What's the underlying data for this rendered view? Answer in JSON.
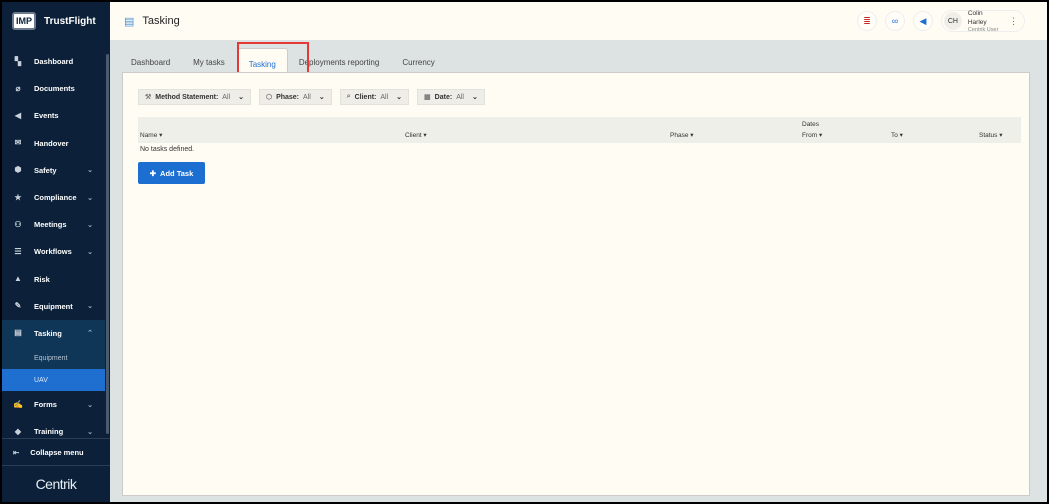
{
  "sidebar": {
    "brand_badge": "IMP",
    "brand": "TrustFlight",
    "items": [
      {
        "label": "Dashboard",
        "icon": "▚"
      },
      {
        "label": "Documents",
        "icon": "⌀"
      },
      {
        "label": "Events",
        "icon": "◀"
      },
      {
        "label": "Handover",
        "icon": "✉"
      },
      {
        "label": "Safety",
        "icon": "⬢"
      },
      {
        "label": "Compliance",
        "icon": "★"
      },
      {
        "label": "Meetings",
        "icon": "⚇"
      },
      {
        "label": "Workflows",
        "icon": "☰"
      },
      {
        "label": "Risk",
        "icon": "▲"
      },
      {
        "label": "Equipment",
        "icon": "✎"
      },
      {
        "label": "Tasking",
        "icon": "▤"
      },
      {
        "label": "Forms",
        "icon": "✍"
      },
      {
        "label": "Training",
        "icon": "◆"
      }
    ],
    "sub_items": [
      "Equipment",
      "UAV"
    ],
    "collapse": "Collapse menu",
    "footer_logo": "Centrik"
  },
  "header": {
    "title": "Tasking",
    "user_initials": "CH",
    "user_name": "Colin Harley",
    "user_role": "Centrik User"
  },
  "tabs": [
    "Dashboard",
    "My tasks",
    "Tasking",
    "Deployments reporting",
    "Currency"
  ],
  "filters": [
    {
      "label": "Method Statement:",
      "value": "All"
    },
    {
      "label": "Phase:",
      "value": "All"
    },
    {
      "label": "Client:",
      "value": "All"
    },
    {
      "label": "Date:",
      "value": "All"
    }
  ],
  "table": {
    "group": "Dates",
    "columns": [
      "Name ▾",
      "Client ▾",
      "Phase ▾",
      "From ▾",
      "To ▾",
      "Status ▾"
    ],
    "empty": "No tasks defined."
  },
  "add_task": "Add Task",
  "colors": {
    "accent": "#1c6fd1",
    "sidebar": "#0c2139",
    "highlight": "#e53935"
  }
}
